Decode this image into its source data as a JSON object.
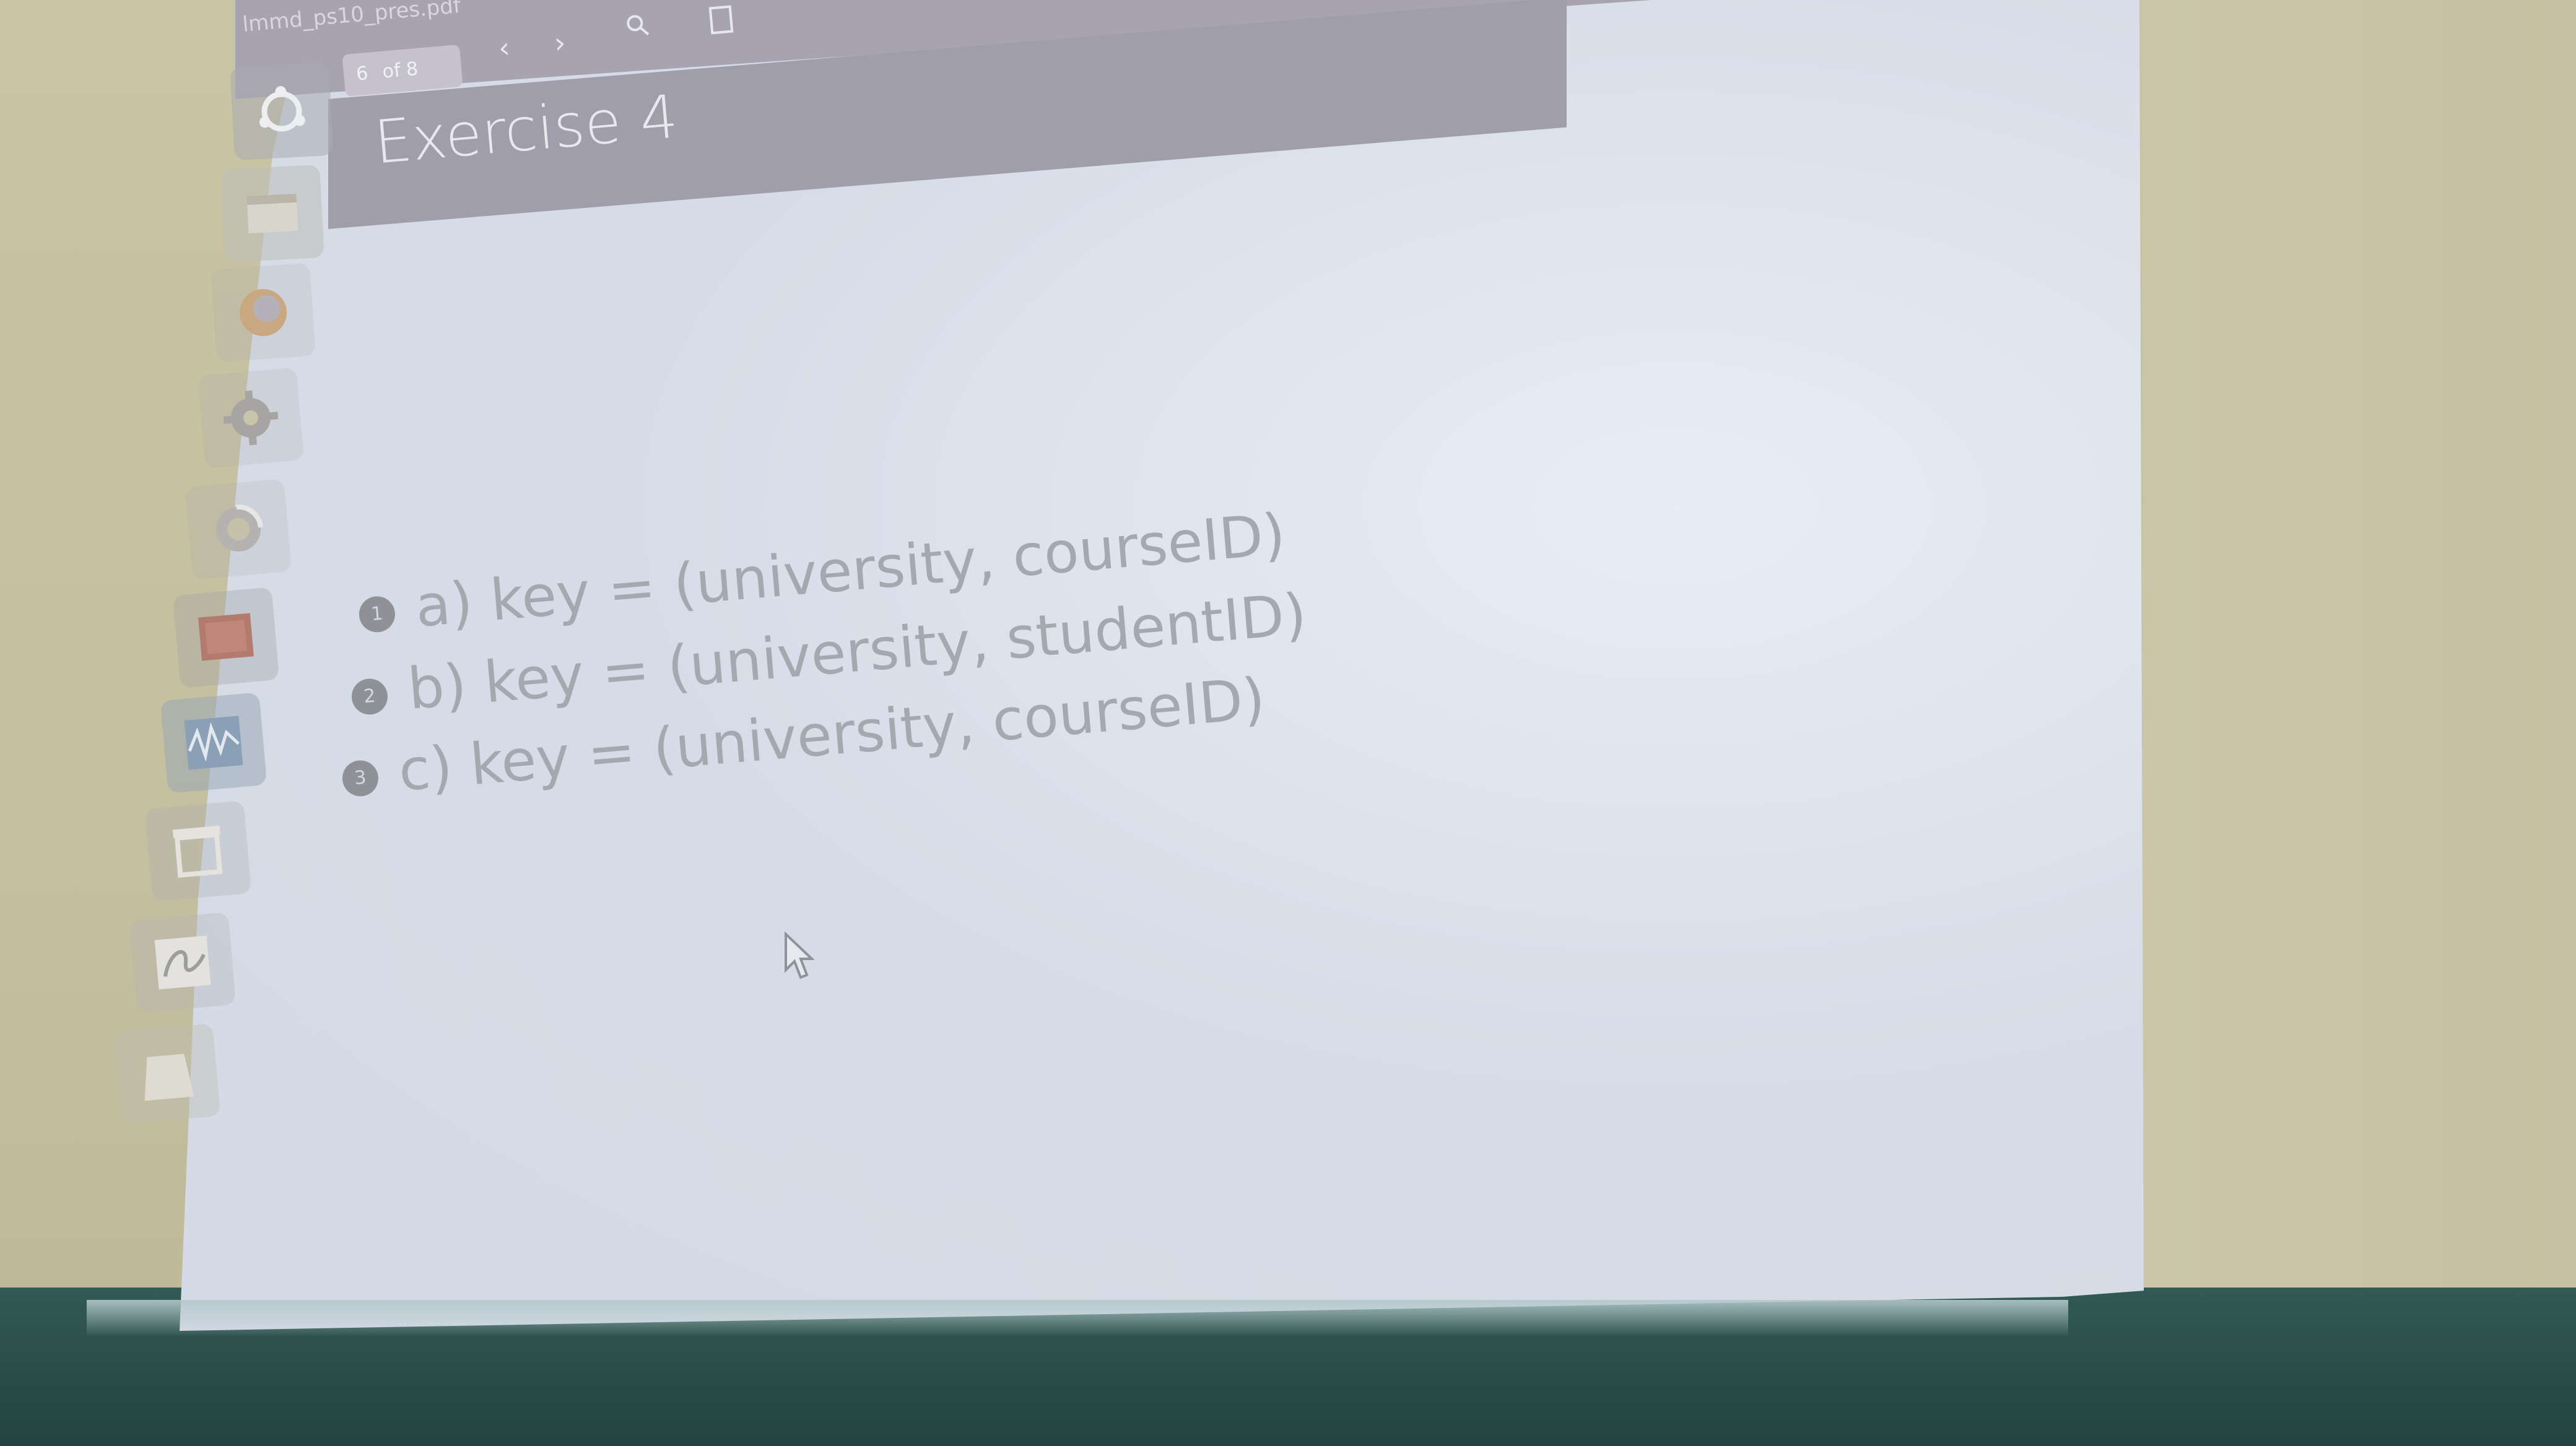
{
  "toolbar": {
    "filename": "lmmd_ps10_pres.pdf",
    "page_number": "6",
    "page_total": "of 8"
  },
  "slide": {
    "title": "Exercise 4",
    "items": [
      {
        "number": "1",
        "text": "a) key = (university, courseID)"
      },
      {
        "number": "2",
        "text": "b) key = (university, studentID)"
      },
      {
        "number": "3",
        "text": "c) key = (university, courseID)"
      }
    ]
  },
  "launcher": {
    "icons": [
      "ubuntu-logo-icon",
      "files-icon",
      "firefox-icon",
      "settings-icon",
      "system-update-icon",
      "presentation-icon",
      "system-monitor-icon",
      "scanner-icon",
      "signature-icon",
      "trash-icon"
    ]
  },
  "colors": {
    "header_bar": "#a19eab",
    "slide_background": "#d5dbe6",
    "text": "#a6a8b0"
  }
}
